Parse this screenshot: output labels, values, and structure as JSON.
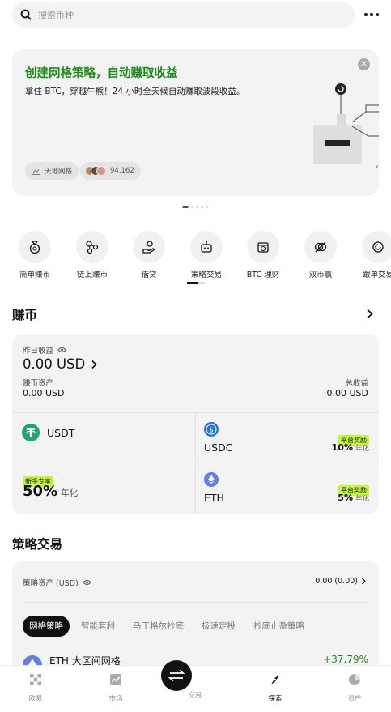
{
  "search": {
    "placeholder": "搜索币种"
  },
  "banner": {
    "title": "创建网格策略，自动赚取收益",
    "subtitle": "拿住 BTC，穿越牛熊！24 小时全天候自动赚取波段收益。",
    "chip_label": "天地网格",
    "user_count": "94,162"
  },
  "quick_actions": [
    {
      "label": "简单赚币",
      "icon": "coin-bag-icon"
    },
    {
      "label": "链上赚币",
      "icon": "chain-nodes-icon"
    },
    {
      "label": "借贷",
      "icon": "hand-coin-icon"
    },
    {
      "label": "策略交易",
      "icon": "robot-icon"
    },
    {
      "label": "BTC 理财",
      "icon": "btc-box-icon"
    },
    {
      "label": "双币赢",
      "icon": "dual-coin-icon"
    },
    {
      "label": "跟单交易",
      "icon": "copy-trade-icon"
    }
  ],
  "earn": {
    "section_title": "赚币",
    "yesterday_label": "昨日收益",
    "yesterday_value": "0.00 USD",
    "assets_label": "赚币资产",
    "assets_value": "0.00 USD",
    "total_label": "总收益",
    "total_value": "0.00 USD",
    "usdt": {
      "name": "USDT",
      "tag": "新手专享",
      "rate": "50%",
      "rate_unit": "年化"
    },
    "usdc": {
      "name": "USDC",
      "tag": "平台奖励",
      "rate": "10%",
      "rate_unit": "年化"
    },
    "eth": {
      "name": "ETH",
      "tag": "平台奖励",
      "rate": "5%",
      "rate_unit": "年化"
    }
  },
  "strategy": {
    "section_title": "策略交易",
    "assets_label": "策略资产 (USD)",
    "assets_value": "0.00 (0.00)",
    "tabs": [
      "网格策略",
      "智能套利",
      "马丁格尔抄底",
      "极速定投",
      "抄底止盈策略"
    ],
    "first_item": {
      "name": "ETH 大区间网格",
      "change": "+37.79%"
    }
  },
  "bottom_nav": [
    {
      "label": "欧易",
      "icon": "okx-logo-icon"
    },
    {
      "label": "市场",
      "icon": "chart-icon"
    },
    {
      "label": "交易",
      "icon": "swap-icon"
    },
    {
      "label": "探索",
      "icon": "compass-icon"
    },
    {
      "label": "资产",
      "icon": "pie-icon"
    }
  ],
  "colors": {
    "accent_green": "#1c8a17",
    "tag_lime": "#c3f53c",
    "usdt": "#26a17b",
    "usdc": "#2775ca",
    "eth": "#627eea"
  }
}
